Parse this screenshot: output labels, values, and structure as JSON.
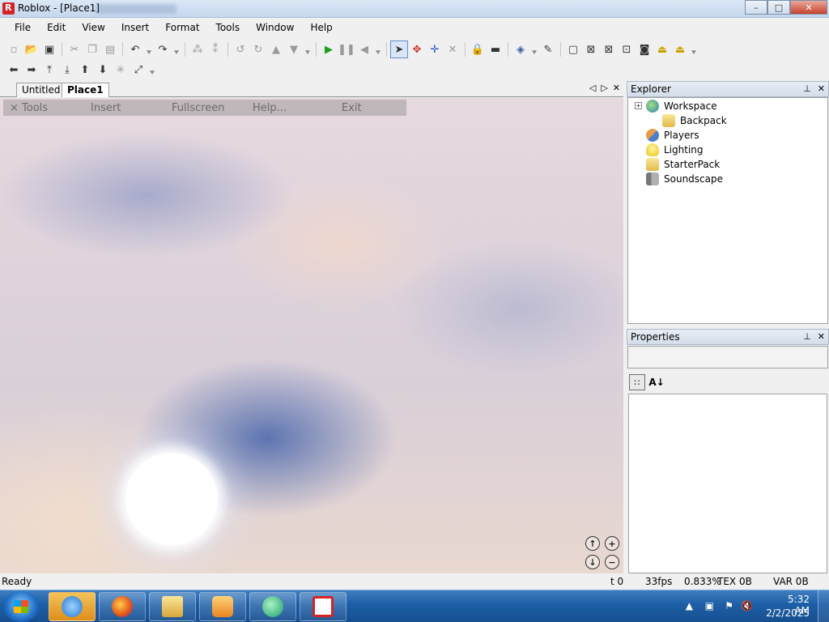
{
  "window": {
    "title": "Roblox - [Place1]",
    "minimize": "–",
    "maximize": "□",
    "close": "✕"
  },
  "menu": {
    "items": [
      "File",
      "Edit",
      "View",
      "Insert",
      "Format",
      "Tools",
      "Window",
      "Help"
    ]
  },
  "tabs": {
    "untitled": "Untitled",
    "active": "Place1",
    "prev": "◁",
    "next": "▷",
    "close": "✕"
  },
  "ingame_menu": {
    "tools": "× Tools",
    "insert": "Insert",
    "fullscreen": "Fullscreen",
    "help": "Help...",
    "exit": "Exit"
  },
  "camera": {
    "up": "↑",
    "down": "↓",
    "zoom_in": "+",
    "zoom_out": "−"
  },
  "explorer": {
    "title": "Explorer",
    "pin": "⊥",
    "close": "✕",
    "items": [
      {
        "label": "Workspace",
        "expander": "+"
      },
      {
        "label": "Backpack"
      },
      {
        "label": "Players"
      },
      {
        "label": "Lighting"
      },
      {
        "label": "StarterPack"
      },
      {
        "label": "Soundscape"
      }
    ]
  },
  "properties": {
    "title": "Properties",
    "pin": "⊥",
    "close": "✕",
    "categorized_icon": "∷",
    "alpha_icon": "A↓"
  },
  "status": {
    "text": "Ready",
    "t": "t 0",
    "fps": "33fps",
    "cpu": "0.833%",
    "tex": "TEX 0B",
    "var": "VAR 0B"
  },
  "taskbar": {
    "apps": [
      "internet-explorer",
      "firefox",
      "file-explorer",
      "media-player",
      "app-green",
      "roblox-studio"
    ],
    "time": "5:32 AM",
    "date": "2/2/2025"
  }
}
